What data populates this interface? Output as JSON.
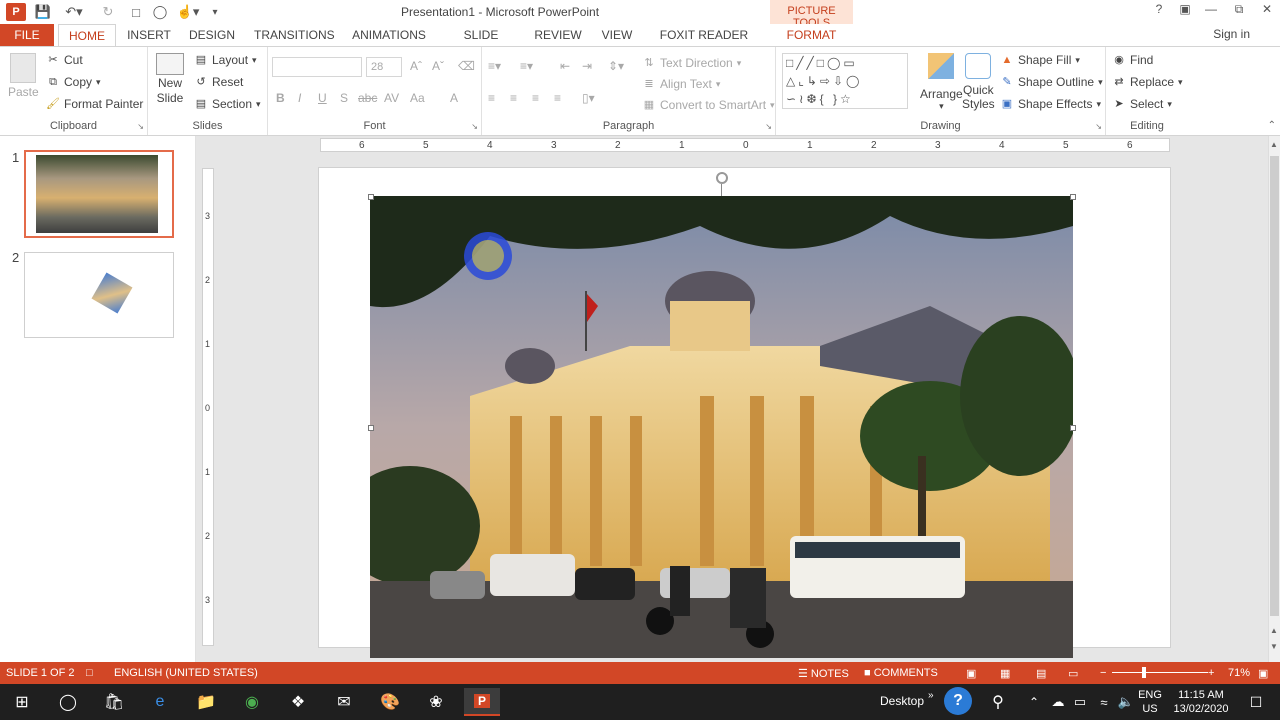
{
  "window": {
    "title": "Presentation1 - Microsoft PowerPoint",
    "context_group": "PICTURE TOOLS",
    "context_tab": "FORMAT",
    "help": "?",
    "sign_in": "Sign in"
  },
  "tabs": [
    "FILE",
    "HOME",
    "INSERT",
    "DESIGN",
    "TRANSITIONS",
    "ANIMATIONS",
    "SLIDE SHOW",
    "REVIEW",
    "VIEW",
    "FOXIT READER PDF"
  ],
  "ribbon": {
    "clipboard": {
      "label": "Clipboard",
      "paste": "Paste",
      "cut": "Cut",
      "copy": "Copy",
      "format_painter": "Format Painter"
    },
    "slides": {
      "label": "Slides",
      "new_slide_1": "New",
      "new_slide_2": "Slide",
      "layout": "Layout",
      "reset": "Reset",
      "section": "Section"
    },
    "font": {
      "label": "Font",
      "size": "28",
      "b": "B",
      "i": "I",
      "u": "U",
      "s": "S",
      "abc": "abc",
      "av": "AV",
      "aa": "Aa",
      "a": "A"
    },
    "paragraph": {
      "label": "Paragraph",
      "text_direction": "Text Direction",
      "align_text": "Align Text",
      "convert_smartart": "Convert to SmartArt"
    },
    "drawing": {
      "label": "Drawing",
      "arrange": "Arrange",
      "quick_1": "Quick",
      "quick_2": "Styles",
      "shape_fill": "Shape Fill",
      "shape_outline": "Shape Outline",
      "shape_effects": "Shape Effects"
    },
    "editing": {
      "label": "Editing",
      "find": "Find",
      "replace": "Replace",
      "select": "Select"
    }
  },
  "slides": [
    {
      "number": "1"
    },
    {
      "number": "2"
    }
  ],
  "ruler": {
    "h": [
      "6",
      "5",
      "4",
      "3",
      "2",
      "1",
      "0",
      "1",
      "2",
      "3",
      "4",
      "5",
      "6"
    ],
    "v": [
      "3",
      "2",
      "1",
      "0",
      "1",
      "2",
      "3"
    ]
  },
  "status": {
    "slide": "SLIDE 1 OF 2",
    "language": "ENGLISH (UNITED STATES)",
    "notes": "NOTES",
    "comments": "COMMENTS",
    "zoom": "71%",
    "zoom_value": 71
  },
  "taskbar": {
    "desktop": "Desktop",
    "lang1": "ENG",
    "lang2": "US",
    "time": "11:15 AM",
    "date": "13/02/2020"
  },
  "colors": {
    "accent": "#d24726",
    "taskbar": "#1f1f1f"
  }
}
